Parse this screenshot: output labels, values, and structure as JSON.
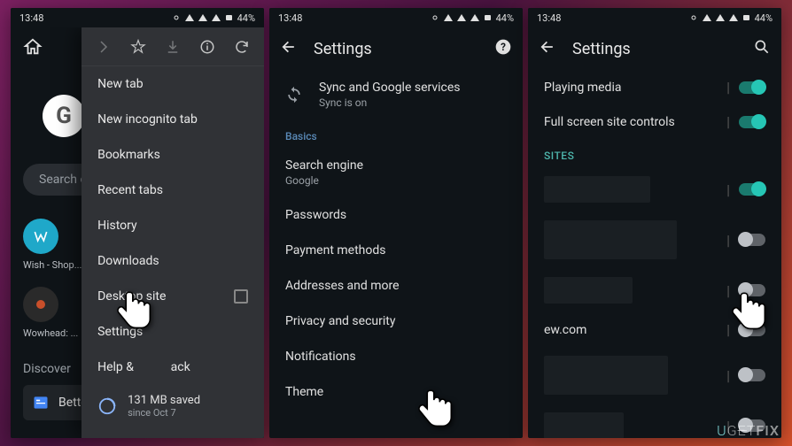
{
  "status": {
    "time": "13:48",
    "battery": "44%"
  },
  "phone1": {
    "search_placeholder": "Search or",
    "tile1": "Wish - Shop...",
    "tile2": "Wowhead: ...",
    "discover": "Discover",
    "card": "Bette",
    "menu": {
      "items": [
        "New tab",
        "New incognito tab",
        "Bookmarks",
        "Recent tabs",
        "History",
        "Downloads",
        "Desktop site",
        "Settings",
        "Help & feedback"
      ],
      "help_visible": "Help &            ack",
      "save_main": "131 MB saved",
      "save_sub": "since Oct 7"
    }
  },
  "phone2": {
    "title": "Settings",
    "sync_main": "Sync and Google services",
    "sync_sub": "Sync is on",
    "basics": "Basics",
    "rows": [
      {
        "main": "Search engine",
        "sub": "Google"
      },
      {
        "main": "Passwords"
      },
      {
        "main": "Payment methods"
      },
      {
        "main": "Addresses and more"
      },
      {
        "main": "Privacy and security"
      },
      {
        "main": "Notifications"
      },
      {
        "main": "Theme"
      }
    ]
  },
  "phone3": {
    "title": "Settings",
    "rows": [
      {
        "label": "Playing media",
        "on": true
      },
      {
        "label": "Full screen site controls",
        "on": true
      }
    ],
    "sites": "SITES",
    "site_label": "ew.com"
  },
  "watermark": "UGETFIX"
}
